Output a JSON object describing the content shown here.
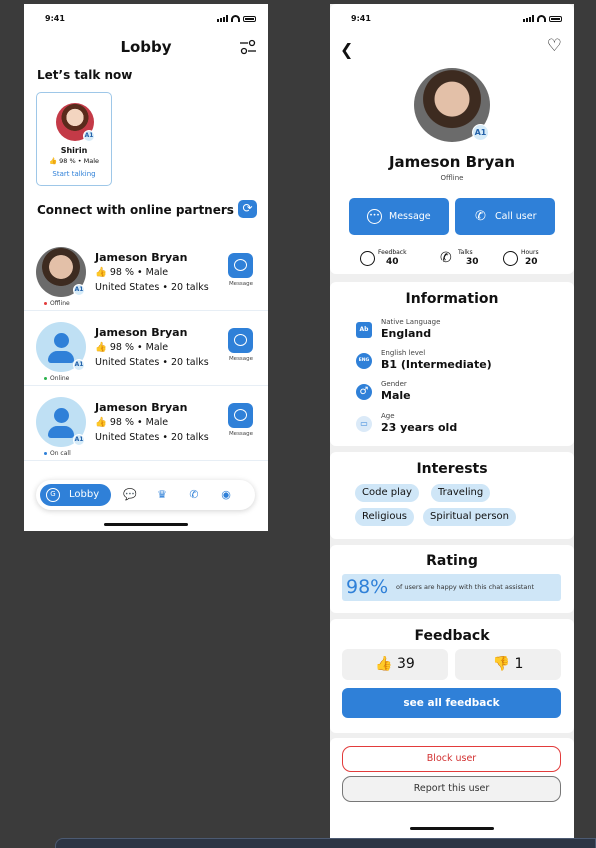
{
  "colors": {
    "accent": "#2f80d8",
    "chip": "#cfe6f7",
    "danger": "#e23b3b",
    "canvas": "#3b3b3b"
  },
  "status_bar": {
    "time": "9:41"
  },
  "lobby": {
    "title": "Lobby",
    "talk_now_heading": "Let’s talk now",
    "featured": {
      "name": "Shirin",
      "meta": "👍 98 % • Male",
      "badge": "A1",
      "action": "Start talking"
    },
    "online_heading": "Connect with online partners",
    "partners": [
      {
        "name": "Jameson Bryan",
        "meta": "👍 98 % • Male",
        "location": "United States • 20 talks",
        "badge": "A1",
        "status": "Offline",
        "status_color": "#e23b3b",
        "action": "Message"
      },
      {
        "name": "Jameson Bryan",
        "meta": "👍 98 % • Male",
        "location": "United States • 20 talks",
        "badge": "A1",
        "status": "Online",
        "status_color": "#2bb24c",
        "action": "Message"
      },
      {
        "name": "Jameson Bryan",
        "meta": "👍 98 % • Male",
        "location": "United States • 20 talks",
        "badge": "A1",
        "status": "On call",
        "status_color": "#2f80d8",
        "action": "Message"
      }
    ],
    "tabbar": {
      "active_label": "Lobby",
      "active_icon": "G"
    }
  },
  "profile": {
    "name": "Jameson Bryan",
    "status": "Offline",
    "badge": "A1",
    "message_label": "Message",
    "call_label": "Call user",
    "stats": [
      {
        "label": "Feedback",
        "value": "40"
      },
      {
        "label": "Talks",
        "value": "30"
      },
      {
        "label": "Hours",
        "value": "20"
      }
    ],
    "information_title": "Information",
    "info": [
      {
        "label": "Native Language",
        "value": "England",
        "icon": "Ab"
      },
      {
        "label": "English level",
        "value": "B1 (Intermediate)",
        "icon": "ENG"
      },
      {
        "label": "Gender",
        "value": "Male",
        "icon": "♂"
      },
      {
        "label": "Age",
        "value": "23 years old",
        "icon": "▭"
      }
    ],
    "interests_title": "Interests",
    "interests": [
      "Code play",
      "Traveling",
      "Religious",
      "Spiritual person"
    ],
    "rating_title": "Rating",
    "rating_percent": "98%",
    "rating_text": "of users are happy with this chat assistant",
    "feedback_title": "Feedback",
    "likes": "👍  39",
    "dislikes": "👎  1",
    "see_all_label": "see all feedback",
    "block_label": "Block user",
    "report_label": "Report this user"
  }
}
